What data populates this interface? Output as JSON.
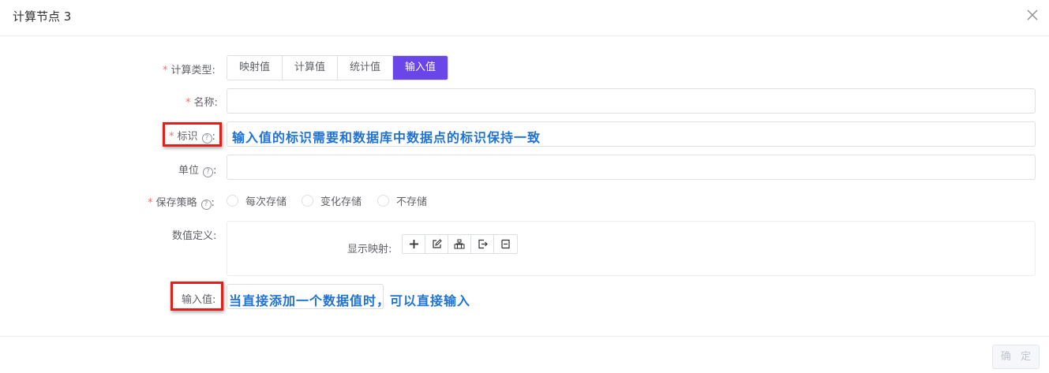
{
  "modal": {
    "title": "计算节点 3",
    "close_icon": "close-icon"
  },
  "form": {
    "calc_type": {
      "label": "计算类型:",
      "options": [
        "映射值",
        "计算值",
        "统计值",
        "输入值"
      ],
      "selected": "输入值"
    },
    "name": {
      "label": "名称:",
      "value": ""
    },
    "identifier": {
      "label": "标识",
      "value": "",
      "help_icon": "question-circle-icon"
    },
    "unit": {
      "label": "单位",
      "value": "",
      "help_icon": "question-circle-icon"
    },
    "save_strategy": {
      "label": "保存策略",
      "options": [
        "每次存储",
        "变化存储",
        "不存储"
      ],
      "selected": null
    },
    "value_definition": {
      "label": "数值定义:",
      "mapping_label": "显示映射:",
      "toolbar_icons": [
        "plus-icon",
        "edit-icon",
        "tree-icon",
        "export-icon",
        "import-icon"
      ]
    },
    "input_value": {
      "label": "输入值:",
      "value": ""
    }
  },
  "annotations": {
    "identifier_note": "输入值的标识需要和数据库中数据点的标识保持一致",
    "input_value_note": "当直接添加一个数据值时，可以直接输入"
  },
  "footer": {
    "confirm_label": "确 定",
    "confirm_enabled": false
  },
  "colors": {
    "accent": "#6a45e8",
    "required": "#f56c6c",
    "highlight_box": "#e0201c",
    "annotation_text": "#1f72d6"
  }
}
